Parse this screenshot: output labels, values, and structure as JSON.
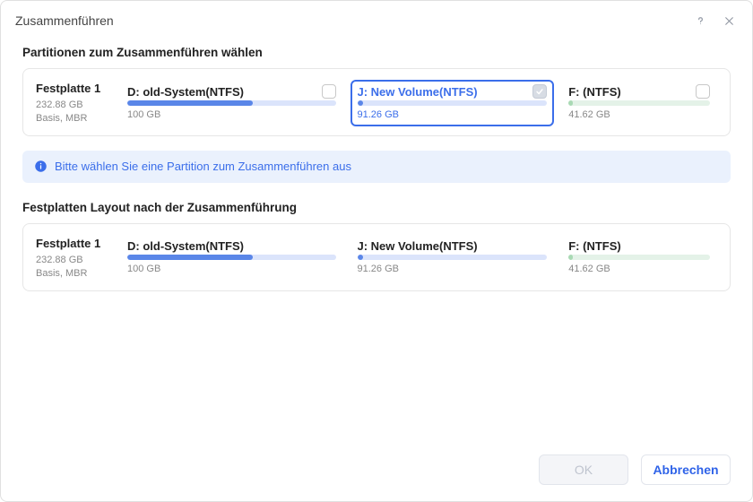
{
  "window": {
    "title": "Zusammenführen"
  },
  "sections": {
    "select_title": "Partitionen zum Zusammenführen wählen",
    "layout_title": "Festplatten Layout nach der Zusammenführung"
  },
  "disk": {
    "name": "Festplatte 1",
    "size": "232.88 GB",
    "scheme": "Basis, MBR"
  },
  "partitions_select": [
    {
      "label": "D: old-System(NTFS)",
      "size": "100 GB",
      "fill_pct": 60,
      "color": "blue",
      "checked": false,
      "selected": false,
      "flex": 1.12
    },
    {
      "label": "J: New Volume(NTFS)",
      "size": "91.26 GB",
      "fill_pct": 3,
      "color": "blue",
      "checked": true,
      "selected": true,
      "flex": 1.02
    },
    {
      "label": "F: (NTFS)",
      "size": "41.62 GB",
      "fill_pct": 3,
      "color": "green",
      "checked": false,
      "selected": false,
      "flex": 0.76
    }
  ],
  "partitions_layout": [
    {
      "label": "D: old-System(NTFS)",
      "size": "100 GB",
      "fill_pct": 60,
      "color": "blue",
      "flex": 1.12
    },
    {
      "label": "J: New Volume(NTFS)",
      "size": "91.26 GB",
      "fill_pct": 3,
      "color": "blue",
      "flex": 1.02
    },
    {
      "label": "F: (NTFS)",
      "size": "41.62 GB",
      "fill_pct": 3,
      "color": "green",
      "flex": 0.76
    }
  ],
  "banner": {
    "text": "Bitte wählen Sie eine Partition zum Zusammenführen aus"
  },
  "buttons": {
    "ok": "OK",
    "cancel": "Abbrechen"
  }
}
